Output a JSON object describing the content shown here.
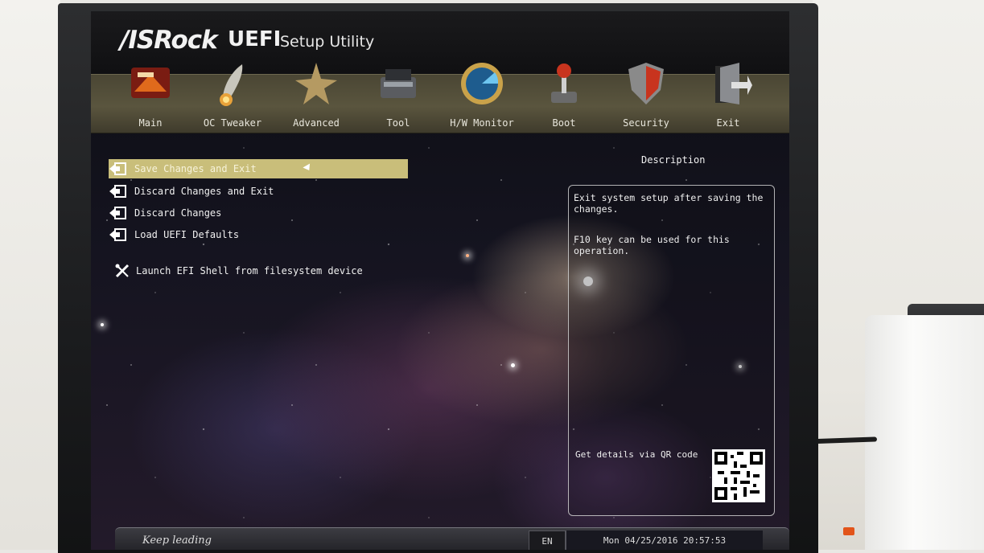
{
  "brand": {
    "logo": "/ISRock",
    "uefi": "UEFI",
    "subtitle": "Setup Utility"
  },
  "tabs": [
    {
      "label": "Main",
      "icon": "main-icon"
    },
    {
      "label": "OC Tweaker",
      "icon": "rocket-icon"
    },
    {
      "label": "Advanced",
      "icon": "star-icon"
    },
    {
      "label": "Tool",
      "icon": "toolbox-icon"
    },
    {
      "label": "H/W Monitor",
      "icon": "radar-icon"
    },
    {
      "label": "Boot",
      "icon": "joystick-icon"
    },
    {
      "label": "Security",
      "icon": "shield-icon"
    },
    {
      "label": "Exit",
      "icon": "exit-door-icon"
    }
  ],
  "active_tab": "Exit",
  "menu": {
    "items": [
      {
        "label": "Save Changes and Exit",
        "icon": "exit-arrow-icon",
        "selected": true
      },
      {
        "label": "Discard Changes and Exit",
        "icon": "exit-arrow-icon",
        "selected": false
      },
      {
        "label": "Discard Changes",
        "icon": "exit-arrow-icon",
        "selected": false
      },
      {
        "label": "Load UEFI Defaults",
        "icon": "exit-arrow-icon",
        "selected": false
      }
    ],
    "shell": {
      "label": "Launch EFI Shell from filesystem device",
      "icon": "tools-icon"
    }
  },
  "description": {
    "title": "Description",
    "line1": "Exit system setup after saving the changes.",
    "line2": "F10 key can be used for this operation.",
    "qr_label": "Get details via QR code"
  },
  "footer": {
    "slogan": "Keep leading",
    "language": "EN",
    "datetime": "Mon 04/25/2016  20:57:53"
  },
  "colors": {
    "selection": "#c9be7a",
    "header_band": "#4a4634",
    "text": "#f0f0f0"
  }
}
